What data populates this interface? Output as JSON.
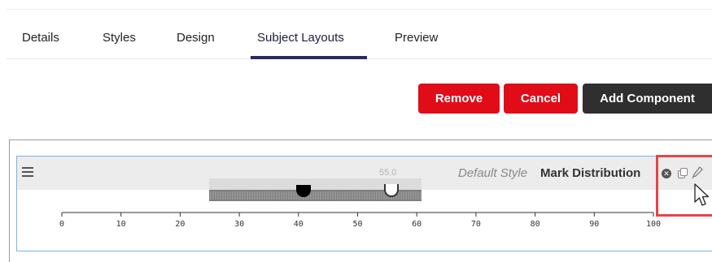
{
  "tabs": {
    "details": "Details",
    "styles": "Styles",
    "design": "Design",
    "subject_layouts": "Subject Layouts",
    "preview": "Preview",
    "active": "Subject Layouts"
  },
  "toolbar": {
    "remove_label": "Remove",
    "cancel_label": "Cancel",
    "add_component_label": "Add Component"
  },
  "component": {
    "style_name": "Default Style",
    "title": "Mark Distribution",
    "slider_value": "55.0",
    "range_low": 41,
    "range_high": 55,
    "axis_min": 0,
    "axis_max": 100,
    "axis_ticks": [
      "0",
      "10",
      "20",
      "30",
      "40",
      "50",
      "60",
      "70",
      "80",
      "90",
      "100"
    ]
  },
  "icons": {
    "menu": "hamburger-icon",
    "remove": "remove-icon",
    "copy": "copy-icon",
    "edit": "edit-icon"
  },
  "colors": {
    "danger": "#e00c17",
    "dark_button": "#2f2f2f",
    "tab_underline": "#262c5e",
    "panel_border": "#7ab4e6",
    "highlight": "#e8434b"
  }
}
